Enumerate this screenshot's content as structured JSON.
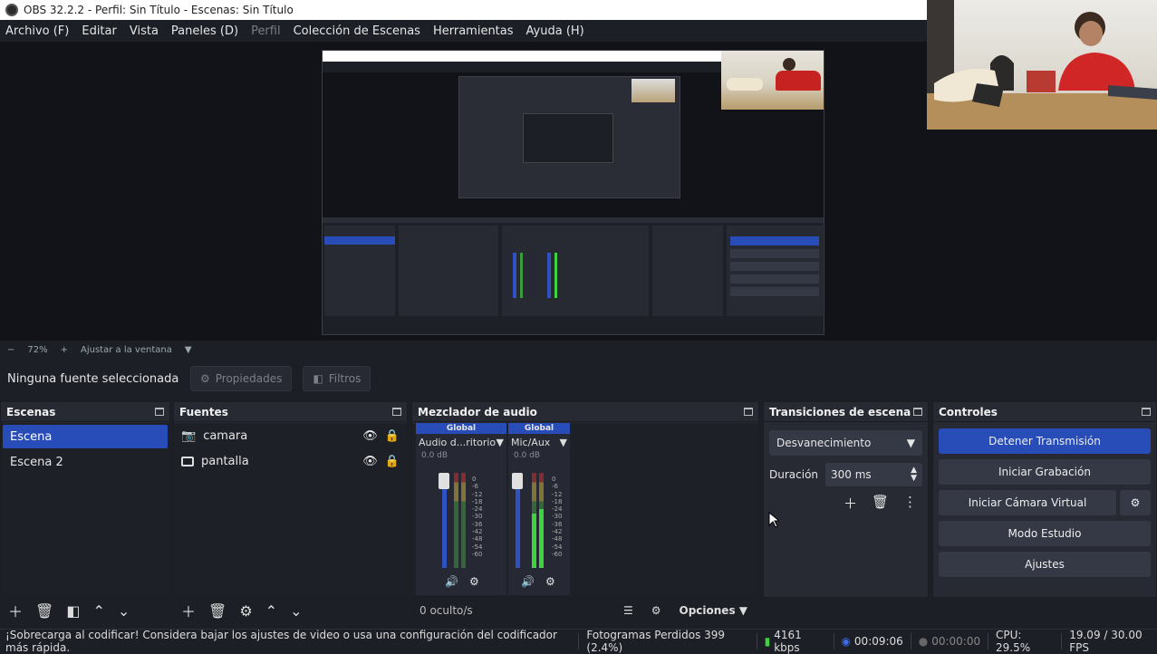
{
  "window": {
    "title": "OBS 32.2.2 - Perfil: Sin Título - Escenas: Sin Título"
  },
  "menu": [
    "Archivo (F)",
    "Editar",
    "Vista",
    "Paneles (D)",
    "Perfil",
    "Colección de Escenas",
    "Herramientas",
    "Ayuda (H)"
  ],
  "zoom": {
    "minus": "−",
    "level": "72%",
    "plus": "+",
    "fit": "Ajustar a la ventana"
  },
  "context": {
    "no_source": "Ninguna fuente seleccionada",
    "properties": "Propiedades",
    "filters": "Filtros"
  },
  "scenes": {
    "title": "Escenas",
    "items": [
      "Escena",
      "Escena 2"
    ]
  },
  "sources": {
    "title": "Fuentes",
    "items": [
      {
        "name": "camara",
        "icon": "camera-icon"
      },
      {
        "name": "pantalla",
        "icon": "monitor-icon"
      }
    ]
  },
  "mixer": {
    "title": "Mezclador de audio",
    "channels": [
      {
        "global": "Global",
        "name": "Audio d...ritorio",
        "db": "0.0 dB"
      },
      {
        "global": "Global",
        "name": "Mic/Aux",
        "db": "0.0 dB"
      }
    ],
    "scale": [
      "0",
      "-6",
      "-12",
      "-18",
      "-24",
      "-30",
      "-36",
      "-42",
      "-48",
      "-54",
      "-60"
    ],
    "hidden": "0 oculto/s",
    "options": "Opciones"
  },
  "transitions": {
    "title": "Transiciones de escena",
    "selected": "Desvanecimiento",
    "duration_label": "Duración",
    "duration_value": "300 ms"
  },
  "controls": {
    "title": "Controles",
    "stop_stream": "Detener Transmisión",
    "start_recording": "Iniciar Grabación",
    "virtual_cam": "Iniciar Cámara Virtual",
    "studio_mode": "Modo Estudio",
    "settings": "Ajustes"
  },
  "status": {
    "warning": "¡Sobrecarga al codificar! Considera bajar los ajustes de video o usa una configuración del codificador más rápida.",
    "dropped": "Fotogramas Perdidos 399 (2.4%)",
    "bitrate": "4161 kbps",
    "stream_time": "00:09:06",
    "rec_time": "00:00:00",
    "cpu": "CPU: 29.5%",
    "fps": "19.09 / 30.00 FPS"
  },
  "colors": {
    "accent": "#284cb8",
    "background": "#1d1f26",
    "panel": "#272a33"
  }
}
